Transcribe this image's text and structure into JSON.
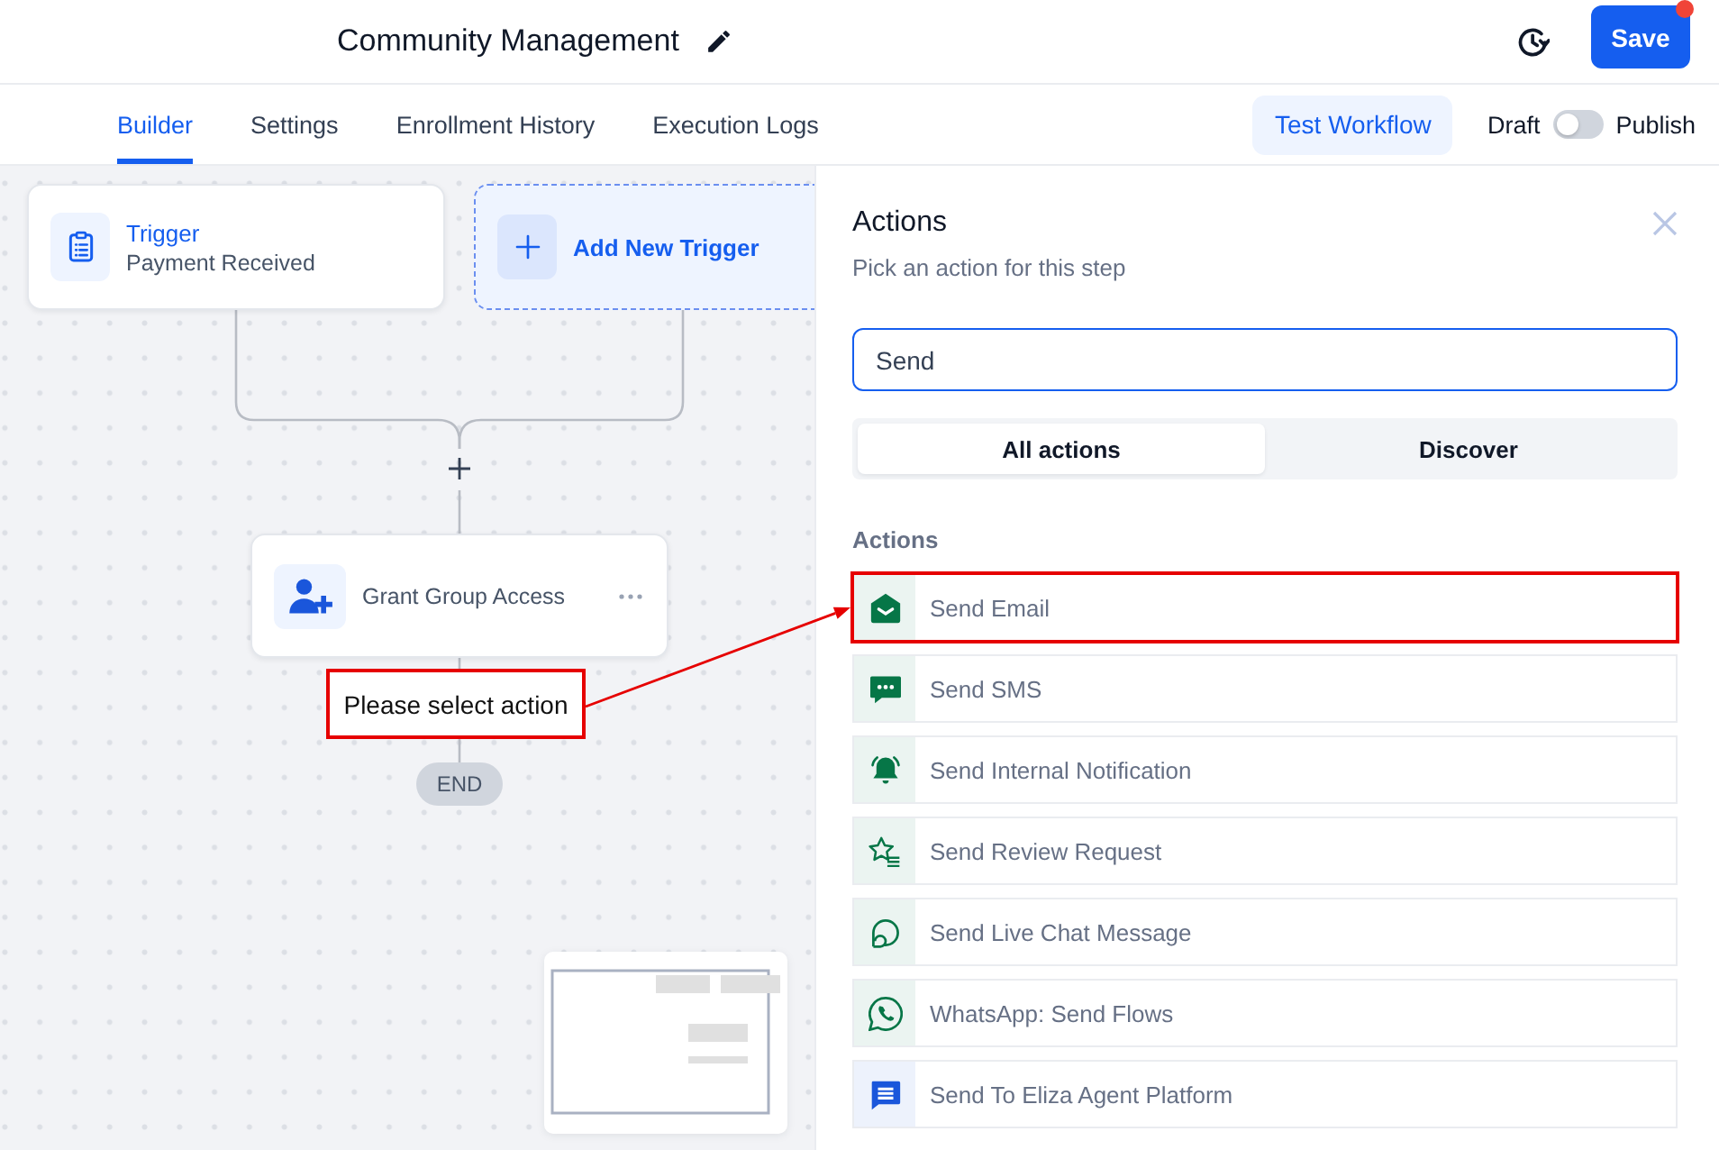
{
  "header": {
    "title": "Community Management",
    "save": {
      "label": "Save",
      "unsaved": true
    }
  },
  "tabs": [
    {
      "label": "Builder",
      "selected": true
    },
    {
      "label": "Settings",
      "selected": false
    },
    {
      "label": "Enrollment History",
      "selected": false
    },
    {
      "label": "Execution Logs",
      "selected": false
    }
  ],
  "test_button": "Test Workflow",
  "publish_toggle": {
    "off_label": "Draft",
    "on_label": "Publish",
    "on": false
  },
  "canvas": {
    "trigger": {
      "title": "Trigger",
      "subtitle": "Payment Received"
    },
    "add_trigger": "Add New Trigger",
    "step": {
      "label": "Grant Group Access"
    },
    "annotation": "Please select action",
    "end": "END"
  },
  "panel": {
    "title": "Actions",
    "subtitle": "Pick an action for this step",
    "search": {
      "value": "Send"
    },
    "segments": [
      {
        "label": "All actions",
        "selected": true
      },
      {
        "label": "Discover",
        "selected": false
      }
    ],
    "section": "Actions",
    "actions": [
      {
        "label": "Send Email",
        "kind": "email",
        "color": "#067647",
        "highlighted": true
      },
      {
        "label": "Send SMS",
        "kind": "sms",
        "color": "#067647",
        "highlighted": false
      },
      {
        "label": "Send Internal Notification",
        "kind": "bell",
        "color": "#067647",
        "highlighted": false
      },
      {
        "label": "Send Review Request",
        "kind": "review",
        "color": "#067647",
        "highlighted": false
      },
      {
        "label": "Send Live Chat Message",
        "kind": "chat",
        "color": "#067647",
        "highlighted": false
      },
      {
        "label": "WhatsApp: Send Flows",
        "kind": "whatsapp",
        "color": "#067647",
        "highlighted": false
      },
      {
        "label": "Send To Eliza Agent Platform",
        "kind": "agent",
        "color": "#1a56db",
        "highlighted": false
      }
    ]
  }
}
